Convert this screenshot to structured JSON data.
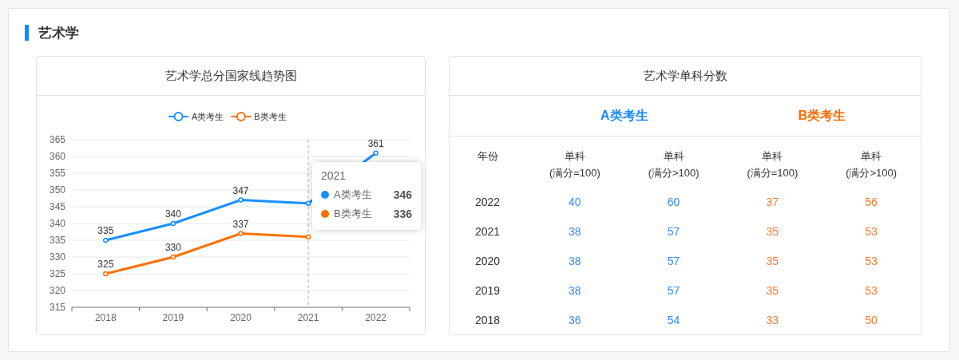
{
  "section": {
    "title": "艺术学"
  },
  "trend_panel": {
    "title": "艺术学总分国家线趋势图",
    "chart_data": {
      "type": "line",
      "categories": [
        "2018",
        "2019",
        "2020",
        "2021",
        "2022"
      ],
      "ylim": [
        315,
        365
      ],
      "yticks": [
        315,
        320,
        325,
        330,
        335,
        340,
        345,
        350,
        355,
        360,
        365
      ],
      "data_labels": true,
      "grid": true,
      "legend": true,
      "ref_lines": [
        {
          "axis": "x",
          "value": "2021"
        }
      ],
      "series": [
        {
          "name": "A类考生",
          "color": "#1890ff",
          "marker": "circle",
          "values": [
            335,
            340,
            347,
            346,
            361
          ],
          "value_labels": [
            "335",
            "340",
            "347",
            null,
            "361"
          ]
        },
        {
          "name": "B类考生",
          "color": "#ff7000",
          "marker": "circle",
          "values": [
            325,
            330,
            337,
            336,
            null
          ],
          "value_labels": [
            "325",
            "330",
            "337",
            null,
            null
          ]
        }
      ]
    },
    "tooltip": {
      "title": "2021",
      "items": [
        {
          "name": "A类考生",
          "value": "346",
          "color": "#1890ff"
        },
        {
          "name": "B类考生",
          "value": "336",
          "color": "#ff7000"
        }
      ]
    }
  },
  "score_panel": {
    "title": "艺术学单科分数",
    "groups": [
      {
        "label": "A类考生",
        "color": "#1e88ff"
      },
      {
        "label": "B类考生",
        "color": "#ff6a00"
      }
    ],
    "columns": [
      {
        "label": "年份",
        "color": "#333333"
      },
      {
        "label": "单科\n(满分=100)",
        "color": "#3388ff"
      },
      {
        "label": "单科\n(满分>100)",
        "color": "#3388ff"
      },
      {
        "label": "单科\n(满分=100)",
        "color": "#ff7a30"
      },
      {
        "label": "单科\n(满分>100)",
        "color": "#ff7a30"
      }
    ],
    "rows": [
      {
        "cells": [
          "2022",
          "40",
          "60",
          "37",
          "56"
        ]
      },
      {
        "cells": [
          "2021",
          "38",
          "57",
          "35",
          "53"
        ]
      },
      {
        "cells": [
          "2020",
          "38",
          "57",
          "35",
          "53"
        ]
      },
      {
        "cells": [
          "2019",
          "38",
          "57",
          "35",
          "53"
        ]
      },
      {
        "cells": [
          "2018",
          "36",
          "54",
          "33",
          "50"
        ]
      }
    ]
  }
}
